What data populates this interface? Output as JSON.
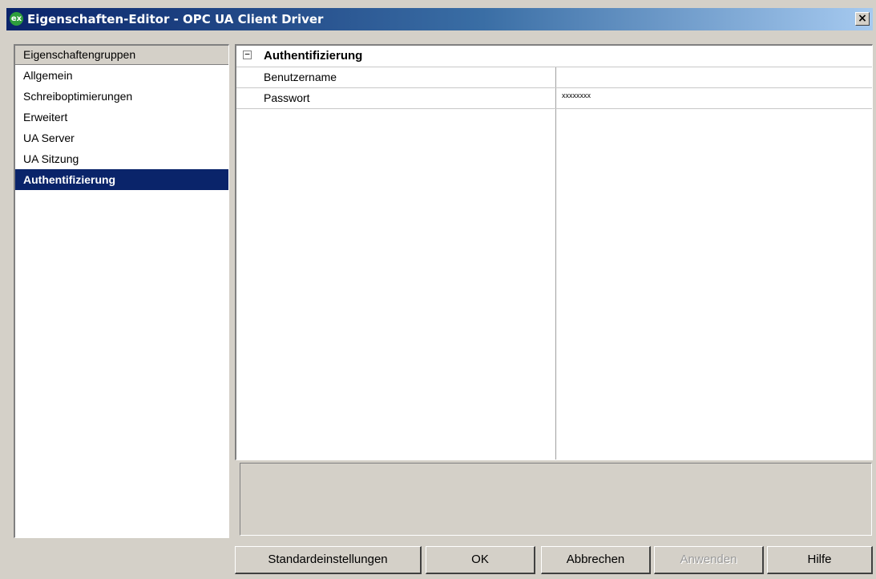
{
  "window": {
    "app_icon_text": "ex",
    "title": "Eigenschaften-Editor - OPC UA Client Driver",
    "close_glyph": "×"
  },
  "left_panel": {
    "header": "Eigenschaftengruppen",
    "items": [
      {
        "label": "Allgemein",
        "selected": false
      },
      {
        "label": "Schreiboptimierungen",
        "selected": false
      },
      {
        "label": "Erweitert",
        "selected": false
      },
      {
        "label": "UA Server",
        "selected": false
      },
      {
        "label": "UA Sitzung",
        "selected": false
      },
      {
        "label": "Authentifizierung",
        "selected": true
      }
    ]
  },
  "property_grid": {
    "group": {
      "collapse_glyph": "−",
      "label": "Authentifizierung"
    },
    "rows": [
      {
        "name": "Benutzername",
        "value": ""
      },
      {
        "name": "Passwort",
        "value": "xxxxxxxx"
      }
    ]
  },
  "description": "",
  "buttons": {
    "defaults": "Standardeinstellungen",
    "ok": "OK",
    "cancel": "Abbrechen",
    "apply": "Anwenden",
    "help": "Hilfe"
  },
  "colors": {
    "title_gradient_start": "#0a246a",
    "title_gradient_end": "#a6caf0",
    "selection": "#0a246a",
    "face": "#d4d0c8"
  }
}
